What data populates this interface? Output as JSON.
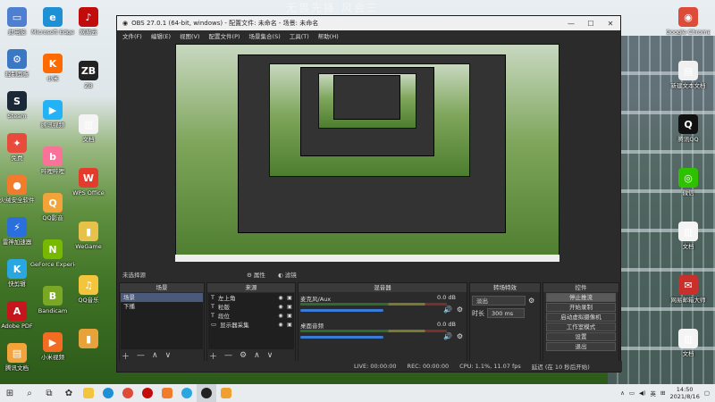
{
  "desktop": {
    "watermark": "无畏先锋 风会三",
    "left_icons_col1": [
      {
        "label": "此电脑",
        "color": "#4f7fd0",
        "glyph": "▭"
      },
      {
        "label": "控制面板",
        "color": "#3b78c4",
        "glyph": "⚙"
      },
      {
        "label": "Steam",
        "color": "#1b2838",
        "glyph": "S"
      },
      {
        "label": "免费",
        "color": "#e84b3c",
        "glyph": "✦"
      },
      {
        "label": "火绒安全软件",
        "color": "#f07c2c",
        "glyph": "●"
      },
      {
        "label": "雷神加速器",
        "color": "#2a6fdb",
        "glyph": "⚡"
      },
      {
        "label": "快剪辑",
        "color": "#2aa7e0",
        "glyph": "K"
      },
      {
        "label": "Adobe PDF",
        "color": "#c4161c",
        "glyph": "A"
      },
      {
        "label": "腾讯文档",
        "color": "#f2a33a",
        "glyph": "▤"
      }
    ],
    "left_icons_col2": [
      {
        "label": "Microsoft Edge",
        "color": "#1f8fd6",
        "glyph": "e"
      },
      {
        "label": "小米",
        "color": "#ff6a00",
        "glyph": "K"
      },
      {
        "label": "腾讯视频",
        "color": "#22b2f5",
        "glyph": "▶"
      },
      {
        "label": "哔哩哔哩",
        "color": "#fb7299",
        "glyph": "b"
      },
      {
        "label": "QQ影音",
        "color": "#f2a33a",
        "glyph": "Q"
      },
      {
        "label": "GeForce Experience",
        "color": "#76b900",
        "glyph": "N"
      },
      {
        "label": "Bandicam",
        "color": "#7aa825",
        "glyph": "B"
      },
      {
        "label": "小米视频",
        "color": "#f26d21",
        "glyph": "▶"
      }
    ],
    "left_icons_col3": [
      {
        "label": "网易云",
        "color": "#c20c0c",
        "glyph": "♪"
      },
      {
        "label": "ZB",
        "color": "#222",
        "glyph": "ZB"
      },
      {
        "label": "文档",
        "color": "#f4f4f4",
        "glyph": "▥"
      },
      {
        "label": "WPS Office",
        "color": "#e33c2c",
        "glyph": "W"
      },
      {
        "label": "WeGame",
        "color": "#e6c24a",
        "glyph": "▮"
      },
      {
        "label": "QQ音乐",
        "color": "#f2c53d",
        "glyph": "♫"
      },
      {
        "label": "",
        "color": "#e8a23a",
        "glyph": "▮"
      }
    ],
    "right_icons": [
      {
        "label": "Google Chrome",
        "color": "#dd4b39",
        "glyph": "◉"
      },
      {
        "label": "新建文本文档",
        "color": "#f0f0f0",
        "glyph": "▤"
      },
      {
        "label": "腾讯QQ",
        "color": "#111",
        "glyph": "Q"
      },
      {
        "label": "微信",
        "color": "#2dc100",
        "glyph": "◎"
      },
      {
        "label": "文档",
        "color": "#f4f4f4",
        "glyph": "▥"
      },
      {
        "label": "网易邮箱大师",
        "color": "#c9302c",
        "glyph": "✉"
      },
      {
        "label": "文档",
        "color": "#f4f4f4",
        "glyph": "▥"
      }
    ]
  },
  "obs": {
    "title": "OBS 27.0.1 (64-bit, windows) - 配置文件: 未命名 - 场景: 未命名",
    "menu": [
      "文件(F)",
      "编辑(E)",
      "视图(V)",
      "配置文件(P)",
      "场景集合(S)",
      "工具(T)",
      "帮助(H)"
    ],
    "scene_header": "未选择源",
    "properties_label": "属性",
    "filters_label": "滤镜",
    "docks": {
      "scenes": {
        "title": "场景",
        "items": [
          "场景",
          "下播"
        ]
      },
      "sources": {
        "title": "来源",
        "items": [
          "左上角",
          "粒版",
          "段位",
          "显示器采集"
        ]
      },
      "mixer": {
        "title": "混音器",
        "channels": [
          {
            "name": "麦克风/Aux",
            "db": "0.0 dB",
            "level": 0.62
          },
          {
            "name": "桌面音频",
            "db": "0.0 dB",
            "level": 0.62
          }
        ]
      },
      "transitions": {
        "title": "转场特效",
        "type": "淡出",
        "duration_label": "时长",
        "duration": "300 ms"
      },
      "controls": {
        "title": "控件",
        "buttons": [
          "停止推流",
          "开始录制",
          "启动虚拟摄像机",
          "工作室模式",
          "设置",
          "退出"
        ]
      }
    },
    "status": {
      "live": "LIVE: 00:00:00",
      "rec": "REC: 00:00:00",
      "cpu": "CPU: 1.1%, 11.07 fps",
      "delay": "延迟 (在 10 秒后开始)"
    }
  },
  "taskbar": {
    "time": "14:50",
    "date": "2021/8/16",
    "lang": "英"
  }
}
